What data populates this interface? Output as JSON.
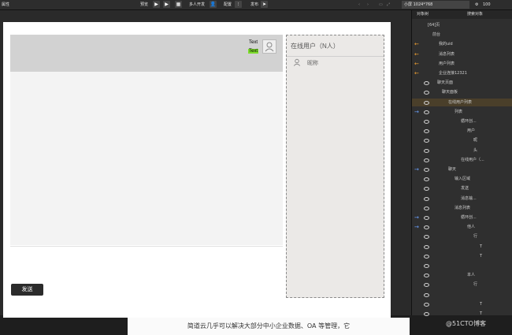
{
  "toolbar": {
    "preview": "预览",
    "multi_dev": "多人开发",
    "config": "配置",
    "publish": "发布",
    "device": "小屏 1024*768",
    "zoom": "100",
    "left_label": "属性"
  },
  "canvas": {
    "msg_text_1": "Text",
    "msg_text_2": "Text",
    "send_label": "发送"
  },
  "user_panel": {
    "title": "在线用户（N人）",
    "nickname": "昵称"
  },
  "right_panel": {
    "tab_objects": "对象树",
    "tab_search": "搜索对象",
    "rows": [
      {
        "label": "[64]页"
      },
      {
        "label": "前台"
      },
      {
        "label": "我的uid"
      },
      {
        "label": "消息列表"
      },
      {
        "label": "用户列表"
      },
      {
        "label": "企业连接12321"
      },
      {
        "label": "聊天页面"
      },
      {
        "label": "聊天面板"
      },
      {
        "label": "在线用户列表"
      },
      {
        "label": "列表"
      },
      {
        "label": "循环创..."
      },
      {
        "label": "用户"
      },
      {
        "label": "昵"
      },
      {
        "label": "头"
      },
      {
        "label": "在线用户（..."
      },
      {
        "label": "聊天"
      },
      {
        "label": "输入区域"
      },
      {
        "label": "发送"
      },
      {
        "label": "消息输..."
      },
      {
        "label": "消息列表"
      },
      {
        "label": "循环创..."
      },
      {
        "label": "他人"
      },
      {
        "label": "行"
      },
      {
        "label": "T"
      },
      {
        "label": "T"
      },
      {
        "label": ""
      },
      {
        "label": "本人"
      },
      {
        "label": "行"
      },
      {
        "label": ""
      },
      {
        "label": "T"
      },
      {
        "label": "T"
      }
    ]
  },
  "caption": "简道云几乎可以解决大部分中小企业数据、OA 等管理，它",
  "watermark": "@51CTO博客",
  "colors": {
    "text_highlight": "#7ddc2c"
  }
}
